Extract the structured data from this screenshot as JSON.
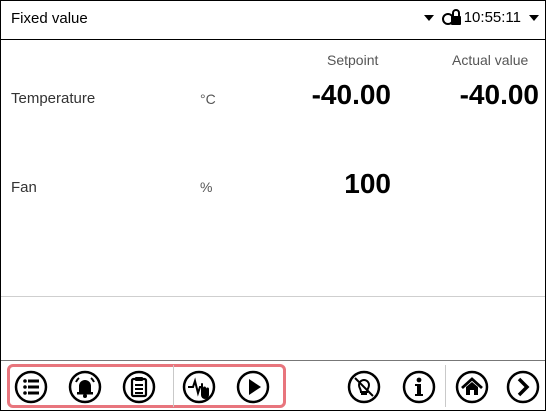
{
  "header": {
    "title": "Fixed value",
    "time": "10:55:11"
  },
  "columns": {
    "setpoint": "Setpoint",
    "actual": "Actual value"
  },
  "rows": [
    {
      "label": "Temperature",
      "unit": "°C",
      "setpoint": "-40.00",
      "actual": "-40.00"
    },
    {
      "label": "Fan",
      "unit": "%",
      "setpoint": "100"
    }
  ],
  "toolbar": {
    "left_icons": [
      "menu-list-icon",
      "alarm-bell-icon",
      "clipboard-icon",
      "program-start-icon",
      "play-icon"
    ],
    "right_icons": [
      "light-off-icon",
      "info-icon",
      "home-icon",
      "next-arrow-icon"
    ],
    "highlight_color": "#e8757d"
  }
}
